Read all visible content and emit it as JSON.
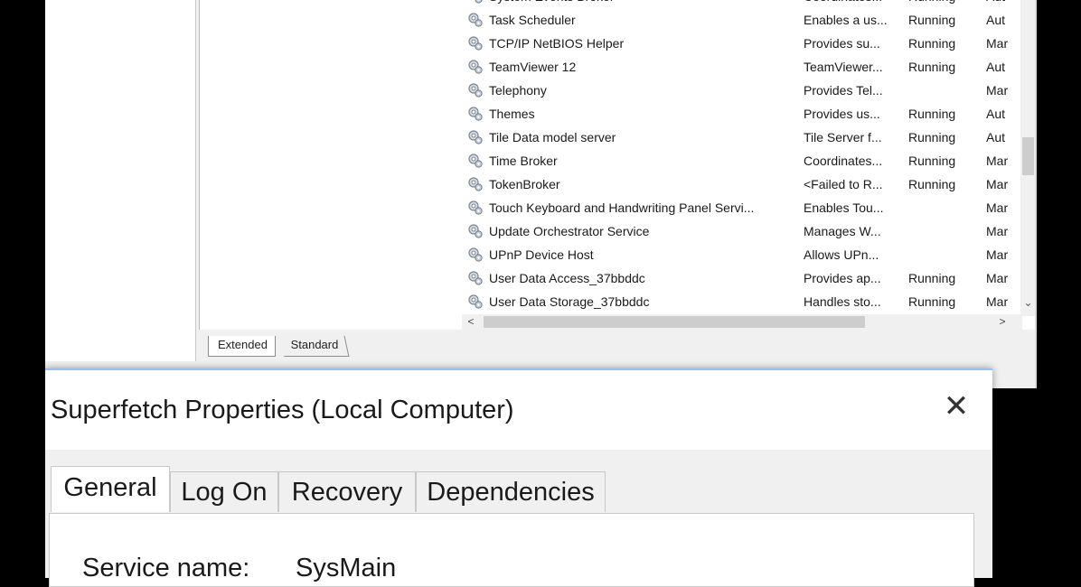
{
  "services": [
    {
      "name": "System Events Broker",
      "description": "Coordinates...",
      "status": "Running",
      "startup": "Aut"
    },
    {
      "name": "Task Scheduler",
      "description": "Enables a us...",
      "status": "Running",
      "startup": "Aut"
    },
    {
      "name": "TCP/IP NetBIOS Helper",
      "description": "Provides su...",
      "status": "Running",
      "startup": "Mar"
    },
    {
      "name": "TeamViewer 12",
      "description": "TeamViewer...",
      "status": "Running",
      "startup": "Aut"
    },
    {
      "name": "Telephony",
      "description": "Provides Tel...",
      "status": "",
      "startup": "Mar"
    },
    {
      "name": "Themes",
      "description": "Provides us...",
      "status": "Running",
      "startup": "Aut"
    },
    {
      "name": "Tile Data model server",
      "description": "Tile Server f...",
      "status": "Running",
      "startup": "Aut"
    },
    {
      "name": "Time Broker",
      "description": "Coordinates...",
      "status": "Running",
      "startup": "Mar"
    },
    {
      "name": "TokenBroker",
      "description": "<Failed to R...",
      "status": "Running",
      "startup": "Mar"
    },
    {
      "name": "Touch Keyboard and Handwriting Panel Servi...",
      "description": "Enables Tou...",
      "status": "",
      "startup": "Mar"
    },
    {
      "name": "Update Orchestrator Service",
      "description": "Manages W...",
      "status": "",
      "startup": "Mar"
    },
    {
      "name": "UPnP Device Host",
      "description": "Allows UPn...",
      "status": "",
      "startup": "Mar"
    },
    {
      "name": "User Data Access_37bbddc",
      "description": "Provides ap...",
      "status": "Running",
      "startup": "Mar"
    },
    {
      "name": "User Data Storage_37bbddc",
      "description": "Handles sto...",
      "status": "Running",
      "startup": "Mar"
    }
  ],
  "view_tabs": {
    "extended": "Extended",
    "standard": "Standard"
  },
  "dialog": {
    "title": "Superfetch Properties (Local Computer)",
    "close_glyph": "✕",
    "tabs": [
      "General",
      "Log On",
      "Recovery",
      "Dependencies"
    ],
    "service_name_label": "Service name:",
    "service_name_value": "SysMain"
  },
  "scroll_glyphs": {
    "left": "<",
    "right": ">",
    "down": "⌄"
  }
}
